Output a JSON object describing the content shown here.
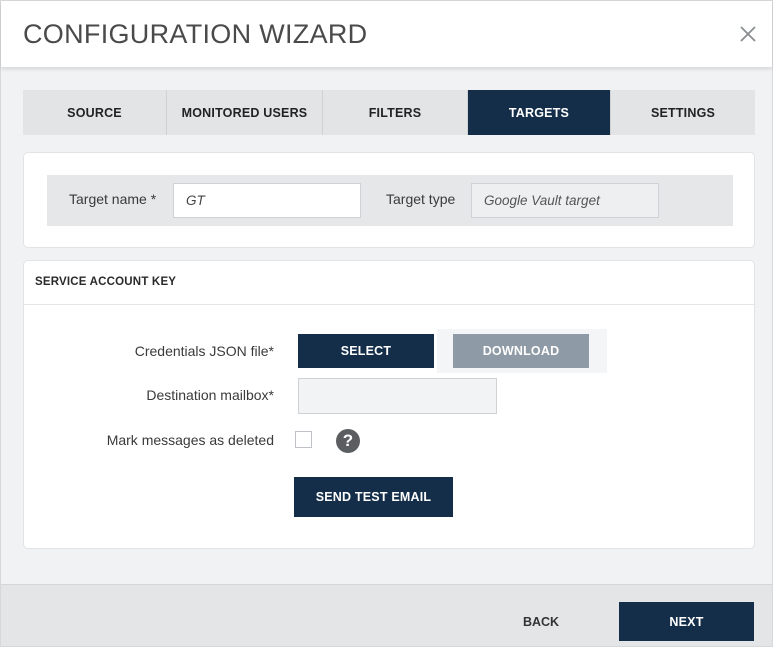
{
  "header": {
    "title": "CONFIGURATION WIZARD"
  },
  "tabs": [
    {
      "label": "SOURCE"
    },
    {
      "label": "MONITORED USERS"
    },
    {
      "label": "FILTERS"
    },
    {
      "label": "TARGETS"
    },
    {
      "label": "SETTINGS"
    }
  ],
  "active_tab": "TARGETS",
  "target": {
    "name_label": "Target name *",
    "name_value": "GT",
    "type_label": "Target type",
    "type_value": "Google Vault target"
  },
  "service_account": {
    "section_title": "SERVICE ACCOUNT KEY",
    "credentials_label": "Credentials JSON file*",
    "select_label": "SELECT",
    "download_label": "DOWNLOAD",
    "mailbox_label": "Destination mailbox*",
    "mailbox_value": "",
    "mark_deleted_label": "Mark messages as deleted",
    "mark_deleted_checked": false,
    "help_icon": "?",
    "send_test_label": "SEND TEST EMAIL"
  },
  "footer": {
    "back_label": "BACK",
    "next_label": "NEXT"
  },
  "colors": {
    "primary": "#142e4a",
    "muted_button": "#8e9aa5",
    "background": "#f1f2f3"
  }
}
